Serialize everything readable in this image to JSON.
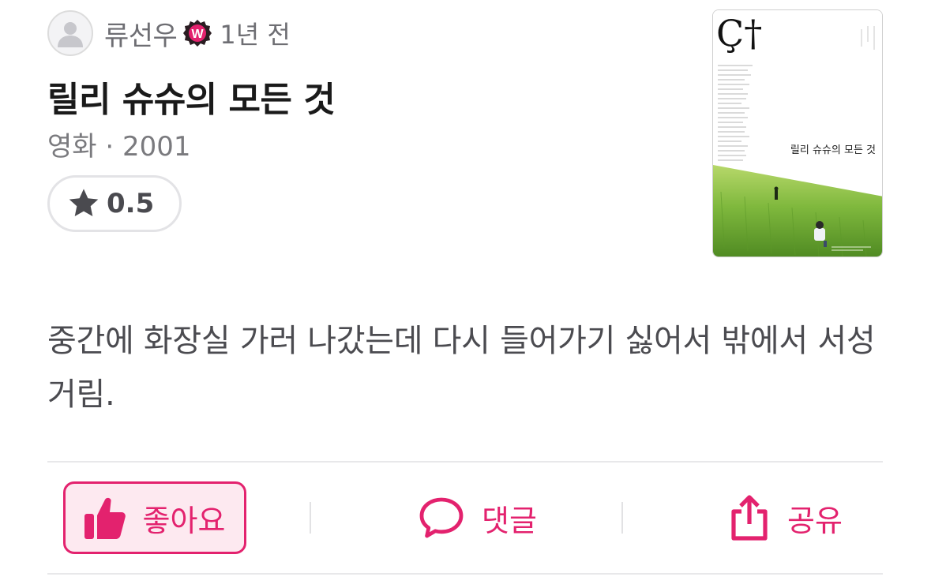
{
  "header": {
    "username": "류선우",
    "badge_letter": "W",
    "time_ago": "1년 전"
  },
  "movie": {
    "title": "릴리 슈슈의 모든 것",
    "meta": "영화 · 2001",
    "rating": "0.5",
    "poster": {
      "logo_text": "Ç†",
      "title_text": "릴리 슈슈의 모든 것"
    }
  },
  "review": {
    "text": "중간에 화장실 가러 나갔는데 다시 들어가기 싫어서 밖에서 서성거림."
  },
  "actions": {
    "like_label": "좋아요",
    "comment_label": "댓글",
    "share_label": "공유"
  },
  "colors": {
    "accent": "#e3226e",
    "accent_bg": "#fde9f0",
    "text_muted": "#6e6e73",
    "divider": "#e8e8ea"
  }
}
